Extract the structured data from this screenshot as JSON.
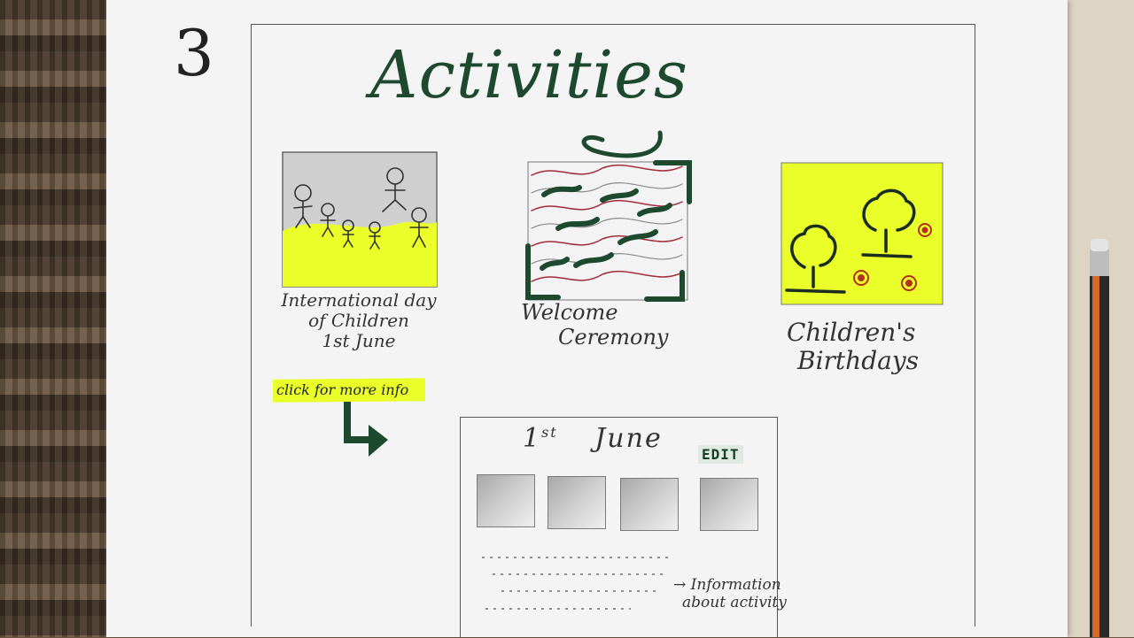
{
  "page_number": "3",
  "title": "Activities",
  "activities": [
    {
      "caption_lines": [
        "International day",
        "of Children",
        "1st June"
      ],
      "image": "children-stick-figures"
    },
    {
      "caption_lines": [
        "Welcome",
        "Ceremony"
      ],
      "image": "abstract-wavy-pattern"
    },
    {
      "caption_lines": [
        "Children's",
        "Birthdays"
      ],
      "image": "trees-and-flowers"
    }
  ],
  "more_info_link": "click for more info",
  "detail": {
    "date_day": "1",
    "date_suffix": "st",
    "date_month": "June",
    "edit_label": "EDIT",
    "info_note_line1": "Information",
    "info_note_line2": "about activity"
  },
  "colors": {
    "ink_green": "#1d4a2e",
    "highlight_yellow": "#eaff2a",
    "paper": "#f4f4f5"
  }
}
